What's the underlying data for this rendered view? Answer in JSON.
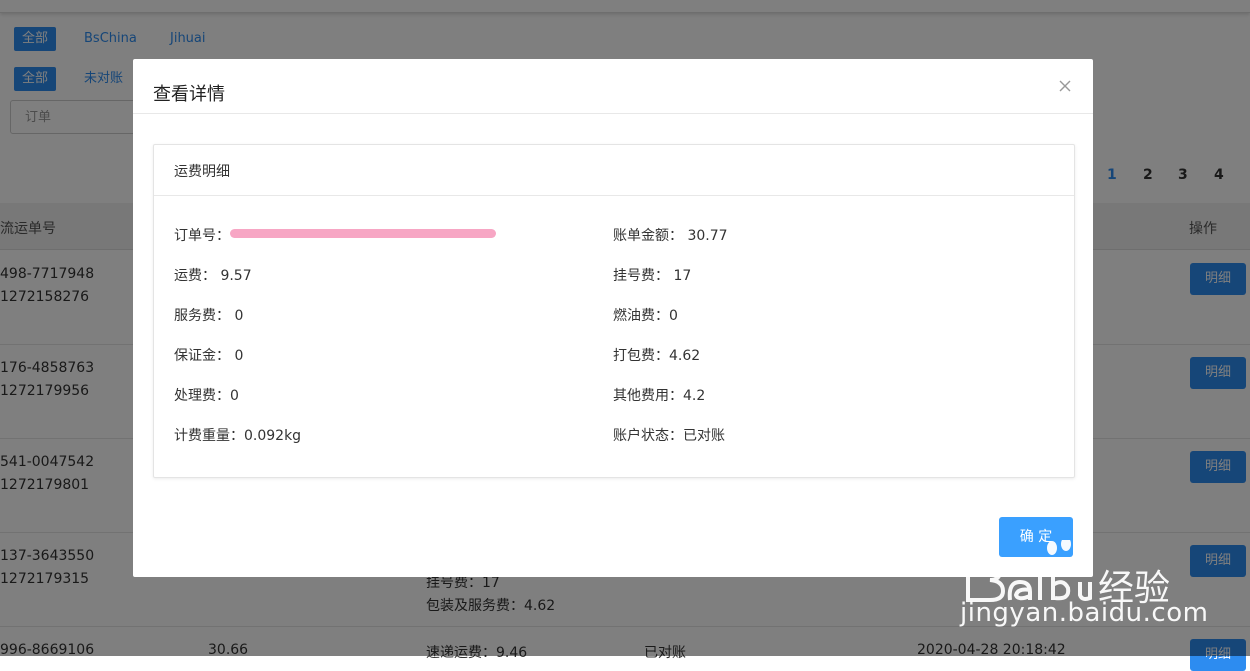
{
  "filters": {
    "platform": {
      "all": "全部",
      "bschina": "BsChina",
      "jihuai": "Jihuai"
    },
    "status": {
      "all": "全部",
      "unreconciled": "未对账"
    },
    "order_placeholder": "订单"
  },
  "pagination": {
    "pages": [
      "1",
      "2",
      "3",
      "4"
    ]
  },
  "table": {
    "headers": {
      "tracking": "流运单号",
      "action": "操作"
    },
    "rows": [
      {
        "tracking": "498-7717948",
        "sub": "1272158276",
        "detail": "明细"
      },
      {
        "tracking": "176-4858763",
        "sub": "1272179956",
        "detail": "明细"
      },
      {
        "tracking": "541-0047542",
        "sub": "1272179801",
        "detail": "明细"
      },
      {
        "tracking": "137-3643550",
        "sub": "1272179315",
        "detail": "明细"
      },
      {
        "tracking": "996-8669106",
        "sub": "",
        "detail": "明细"
      }
    ],
    "extra": {
      "reg_fee": "挂号费：17",
      "pack_fee": "包装及服务费：4.62",
      "amount": "30.66",
      "express_fee": "速递运费：9.46",
      "status": "已对账",
      "date": "2020-04-28 20:18:42"
    }
  },
  "modal": {
    "title": "查看详情",
    "card_title": "运费明细",
    "fields": {
      "order_no": "订单号：",
      "bill_amount": "账单金额： 30.77",
      "freight": "运费： 9.57",
      "reg_fee": "挂号费： 17",
      "service_fee": "服务费： 0",
      "fuel_fee": "燃油费：0",
      "deposit": "保证金： 0",
      "pack_fee": "打包费：4.62",
      "handling_fee": "处理费：0",
      "other_fee": "其他费用：4.2",
      "weight": "计费重量：0.092kg",
      "account_status": "账户状态：已对账"
    },
    "confirm": "确 定"
  },
  "watermark": {
    "text": "jingyan.baidu.com"
  }
}
